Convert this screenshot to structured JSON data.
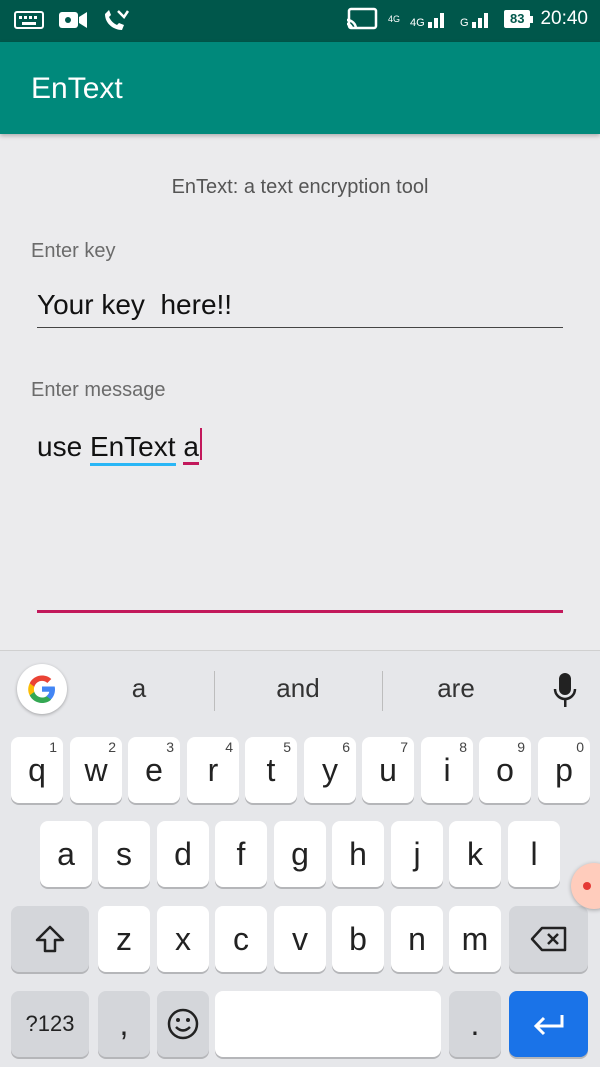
{
  "status_bar": {
    "time": "20:40",
    "battery": "83",
    "signal1_tag": "4G",
    "signal2_tag": "4G",
    "signal2_sub": "R",
    "signal3_sub": "G"
  },
  "app_bar": {
    "title": "EnText"
  },
  "main": {
    "subtitle": "EnText: a text encryption tool",
    "key_label": "Enter key",
    "key_value": "Your key  here!!",
    "message_label": "Enter message",
    "message_word1": "use ",
    "message_word2": "EnText",
    "message_word3": "a"
  },
  "keyboard": {
    "suggestions": [
      "a",
      "and",
      "are"
    ],
    "row1": [
      {
        "k": "q",
        "n": "1"
      },
      {
        "k": "w",
        "n": "2"
      },
      {
        "k": "e",
        "n": "3"
      },
      {
        "k": "r",
        "n": "4"
      },
      {
        "k": "t",
        "n": "5"
      },
      {
        "k": "y",
        "n": "6"
      },
      {
        "k": "u",
        "n": "7"
      },
      {
        "k": "i",
        "n": "8"
      },
      {
        "k": "o",
        "n": "9"
      },
      {
        "k": "p",
        "n": "0"
      }
    ],
    "row2": [
      "a",
      "s",
      "d",
      "f",
      "g",
      "h",
      "j",
      "k",
      "l"
    ],
    "row3": [
      "z",
      "x",
      "c",
      "v",
      "b",
      "n",
      "m"
    ],
    "symbols_key": "?123",
    "comma_key": ",",
    "period_key": ".",
    "accent_color": "#c2185b",
    "enter_color": "#1a73e8"
  }
}
